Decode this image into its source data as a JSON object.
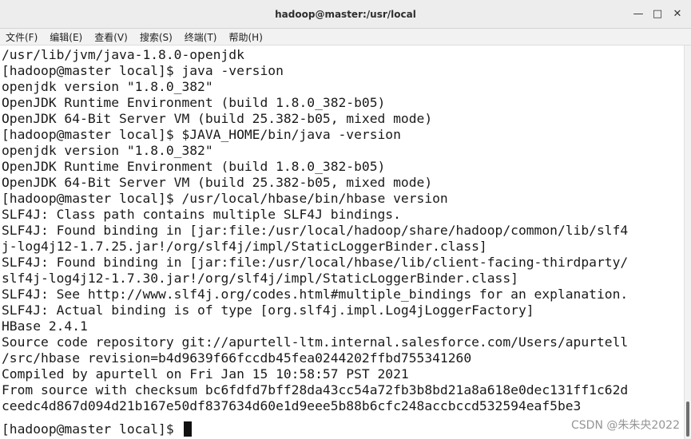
{
  "window": {
    "title": "hadoop@master:/usr/local",
    "minimize_glyph": "—",
    "maximize_glyph": "□",
    "close_glyph": "✕"
  },
  "menu": {
    "items": [
      "文件(F)",
      "编辑(E)",
      "查看(V)",
      "搜索(S)",
      "终端(T)",
      "帮助(H)"
    ]
  },
  "terminal": {
    "lines": [
      "/usr/lib/jvm/java-1.8.0-openjdk",
      "[hadoop@master local]$ java -version",
      "openjdk version \"1.8.0_382\"",
      "OpenJDK Runtime Environment (build 1.8.0_382-b05)",
      "OpenJDK 64-Bit Server VM (build 25.382-b05, mixed mode)",
      "[hadoop@master local]$ $JAVA_HOME/bin/java -version",
      "openjdk version \"1.8.0_382\"",
      "OpenJDK Runtime Environment (build 1.8.0_382-b05)",
      "OpenJDK 64-Bit Server VM (build 25.382-b05, mixed mode)",
      "[hadoop@master local]$ /usr/local/hbase/bin/hbase version",
      "SLF4J: Class path contains multiple SLF4J bindings.",
      "SLF4J: Found binding in [jar:file:/usr/local/hadoop/share/hadoop/common/lib/slf4",
      "j-log4j12-1.7.25.jar!/org/slf4j/impl/StaticLoggerBinder.class]",
      "SLF4J: Found binding in [jar:file:/usr/local/hbase/lib/client-facing-thirdparty/",
      "slf4j-log4j12-1.7.30.jar!/org/slf4j/impl/StaticLoggerBinder.class]",
      "SLF4J: See http://www.slf4j.org/codes.html#multiple_bindings for an explanation.",
      "SLF4J: Actual binding is of type [org.slf4j.impl.Log4jLoggerFactory]",
      "HBase 2.4.1",
      "Source code repository git://apurtell-ltm.internal.salesforce.com/Users/apurtell",
      "/src/hbase revision=b4d9639f66fccdb45fea0244202ffbd755341260",
      "Compiled by apurtell on Fri Jan 15 10:58:57 PST 2021",
      "From source with checksum bc6fdfd7bff28da43cc54a72fb3b8bd21a8a618e0dec131ff1c62d",
      "ceedc4d867d094d21b167e50df837634d60e1d9eee5b88b6cfc248accbccd532594eaf5be3"
    ],
    "prompt": "[hadoop@master local]$ "
  },
  "watermark": "CSDN @朱朱央2022"
}
